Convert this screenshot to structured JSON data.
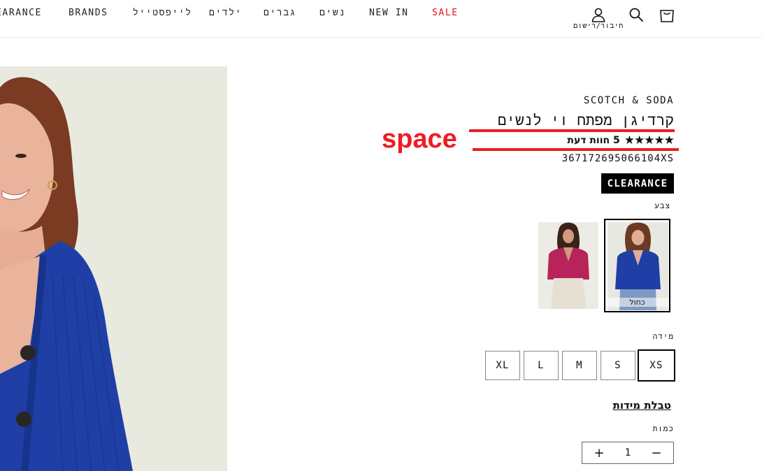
{
  "nav": {
    "items": [
      "EARANCE",
      "BRANDS",
      "לייפסטייל",
      "ילדים",
      "גברים",
      "נשים",
      "NEW IN",
      "SALE"
    ],
    "login_label": "חיבור/רישום"
  },
  "product": {
    "brand": "SCOTCH & SODA",
    "title": "קרדיגן מפתח וי לנשים",
    "rating_stars": "★★★★★",
    "rating_text": "5 חוות דעת",
    "rating_value": 5,
    "sku": "367172695066104XS",
    "badge": "CLEARANCE",
    "color_label": "צבע",
    "colors": [
      {
        "name": "כחול",
        "selected": true
      },
      {
        "name": "",
        "selected": false
      }
    ],
    "size_label": "מידה",
    "sizes": [
      "XL",
      "L",
      "M",
      "S",
      "XS"
    ],
    "selected_size": "XS",
    "size_chart_link": "טבלת מידות",
    "quantity_label": "כמות",
    "quantity": "1",
    "qty_plus": "+",
    "qty_minus": "−"
  },
  "annotation": {
    "label": "space",
    "color": "#ef1b23"
  },
  "colors": {
    "sale": "#e3121b",
    "badge_bg": "#000000",
    "knit_blue": "#1f3fa6",
    "magenta": "#b8235a"
  }
}
